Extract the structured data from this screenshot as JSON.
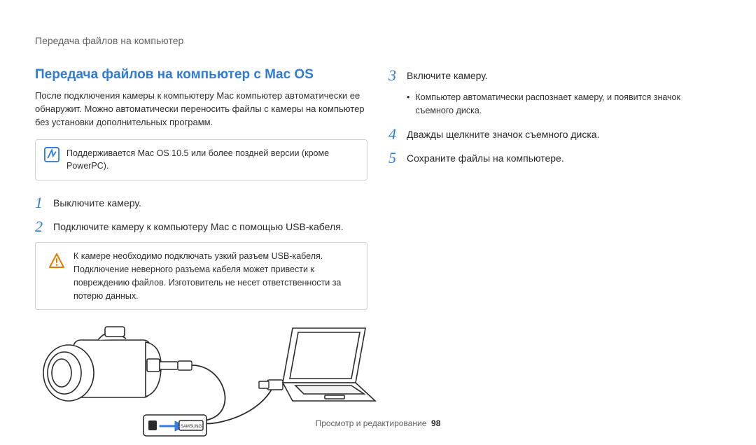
{
  "breadcrumb": "Передача файлов на компьютер",
  "left": {
    "title": "Передача файлов на компьютер с Mac OS",
    "intro": "После подключения камеры к компьютеру Mac компьютер автоматически ее обнаружит. Можно автоматически переносить файлы с камеры на компьютер без установки дополнительных программ.",
    "note": "Поддерживается Mac OS 10.5 или более поздней версии (кроме PowerPC).",
    "step1_num": "1",
    "step1_text": "Выключите камеру.",
    "step2_num": "2",
    "step2_text": "Подключите камеру к компьютеру Mac с помощью USB-кабеля.",
    "warn": "К камере необходимо подключать узкий разъем USB-кабеля. Подключение неверного разъема кабеля может привести к повреждению файлов. Изготовитель не несет ответственности за потерю данных."
  },
  "right": {
    "step3_num": "3",
    "step3_text": "Включите камеру.",
    "step3_sub": "Компьютер автоматически распознает камеру, и появится значок съемного диска.",
    "step4_num": "4",
    "step4_text": "Дважды щелкните значок съемного диска.",
    "step5_num": "5",
    "step5_text": "Сохраните файлы на компьютере."
  },
  "footer": {
    "section": "Просмотр и редактирование",
    "page": "98"
  }
}
